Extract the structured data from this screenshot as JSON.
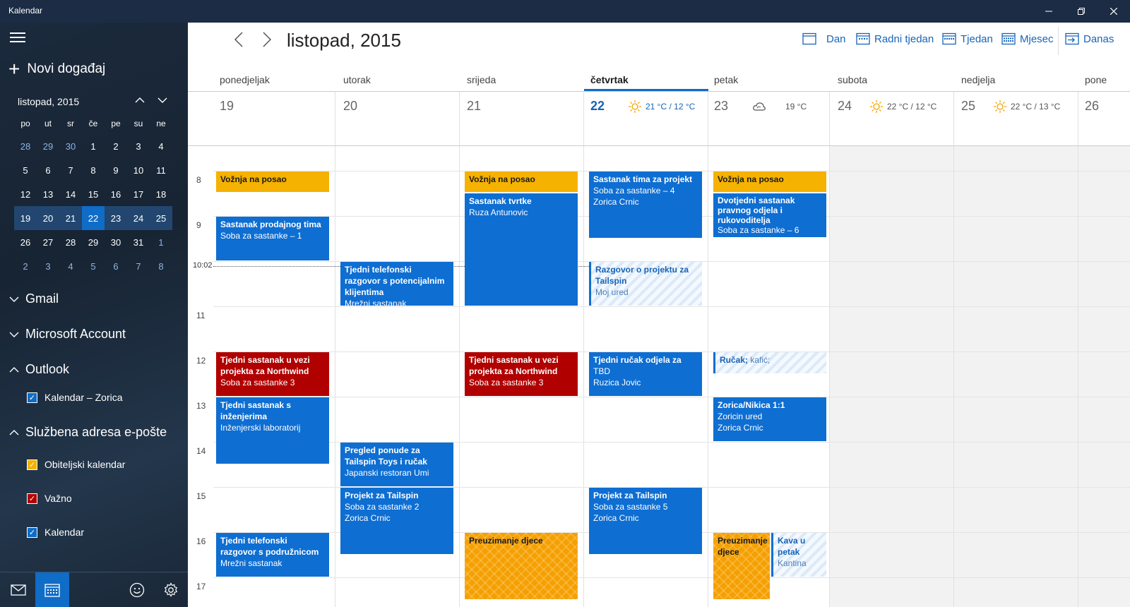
{
  "window": {
    "title": "Kalendar"
  },
  "sidebar": {
    "new_event": "Novi događaj",
    "mini_month": "listopad, 2015",
    "weekdays": [
      "po",
      "ut",
      "sr",
      "če",
      "pe",
      "su",
      "ne"
    ],
    "weeks": [
      [
        "28",
        "29",
        "30",
        "1",
        "2",
        "3",
        "4"
      ],
      [
        "5",
        "6",
        "7",
        "8",
        "9",
        "10",
        "11"
      ],
      [
        "12",
        "13",
        "14",
        "15",
        "16",
        "17",
        "18"
      ],
      [
        "19",
        "20",
        "21",
        "22",
        "23",
        "24",
        "25"
      ],
      [
        "26",
        "27",
        "28",
        "29",
        "30",
        "31",
        "1"
      ],
      [
        "2",
        "3",
        "4",
        "5",
        "6",
        "7",
        "8"
      ]
    ],
    "accounts": {
      "gmail": "Gmail",
      "microsoft": "Microsoft Account",
      "outlook": "Outlook",
      "work": "Službena adresa e-pošte"
    },
    "calendars": {
      "zorica": {
        "label": "Kalendar – Zorica",
        "color": "#0f6cc7"
      },
      "family": {
        "label": "Obiteljski kalendar",
        "color": "#f5b200"
      },
      "important": {
        "label": "Važno",
        "color": "#b10000"
      },
      "calendar": {
        "label": "Kalendar",
        "color": "#0f6cc7"
      }
    }
  },
  "header": {
    "title": "listopad, 2015",
    "views": {
      "day": "Dan",
      "work_week": "Radni tjedan",
      "week": "Tjedan",
      "month": "Mjesec",
      "today": "Danas"
    }
  },
  "days": [
    {
      "name": "ponedjeljak",
      "num": "19",
      "weather": ""
    },
    {
      "name": "utorak",
      "num": "20",
      "weather": ""
    },
    {
      "name": "srijeda",
      "num": "21",
      "weather": ""
    },
    {
      "name": "četvrtak",
      "num": "22",
      "weather": "21 °C / 12 °C"
    },
    {
      "name": "petak",
      "num": "23",
      "weather": "19 °C"
    },
    {
      "name": "subota",
      "num": "24",
      "weather": "22 °C / 12 °C"
    },
    {
      "name": "nedjelja",
      "num": "25",
      "weather": "22 °C / 13 °C"
    },
    {
      "name": "pone",
      "num": "26",
      "weather": ""
    }
  ],
  "hours": [
    "8",
    "9",
    "11",
    "12",
    "13",
    "14",
    "15",
    "16",
    "17"
  ],
  "now_time": "10:02",
  "events": {
    "mon_commute": {
      "title": "Vožnja na posao"
    },
    "mon_sales": {
      "title": "Sastanak prodajnog tima",
      "sub": "Soba za sastanke – 1"
    },
    "mon_northwind": {
      "title": "Tjedni sastanak u vezi projekta za Northwind",
      "sub": "Soba za sastanke 3"
    },
    "mon_eng": {
      "title": "Tjedni sastanak s inženjerima",
      "sub": "Inženjerski laboratorij"
    },
    "mon_phone": {
      "title": "Tjedni telefonski razgovor s podružnicom",
      "sub": "Mrežni sastanak"
    },
    "tue_phone": {
      "title": "Tjedni telefonski razgovor s potencijalnim klijentima",
      "sub": "Mrežni sastanak"
    },
    "tue_review": {
      "title": "Pregled ponude za Tailspin Toys i ručak",
      "sub": "Japanski restoran Umi"
    },
    "tue_tailspin": {
      "title": "Projekt za Tailspin",
      "sub": "Soba za sastanke 2",
      "sub2": "Zorica Crnic"
    },
    "wed_commute": {
      "title": "Vožnja na posao"
    },
    "wed_company": {
      "title": "Sastanak tvrtke",
      "sub": "Ruza Antunovic"
    },
    "wed_northwind": {
      "title": "Tjedni sastanak u vezi projekta za Northwind",
      "sub": "Soba za sastanke 3"
    },
    "wed_kids": {
      "title": "Preuzimanje djece"
    },
    "thu_team": {
      "title": "Sastanak tima za projekt",
      "sub": "Soba za sastanke – 4",
      "sub2": "Zorica Crnic"
    },
    "thu_call": {
      "title": "Razgovor o projektu za Tailspin",
      "sub": "Moj ured"
    },
    "thu_lunch": {
      "title": "Tjedni ručak odjela za",
      "sub": "TBD",
      "sub2": "Ruzica Jovic"
    },
    "thu_tailspin": {
      "title": "Projekt za Tailspin",
      "sub": "Soba za sastanke 5",
      "sub2": "Zorica Crnic"
    },
    "fri_commute": {
      "title": "Vožnja na posao"
    },
    "fri_legal": {
      "title": "Dvotjedni sastanak pravnog odjela i rukovoditelja",
      "sub": "Soba za sastanke – 6"
    },
    "fri_lunch": {
      "title": "Ručak;",
      "sub": "kafić;"
    },
    "fri_oneonone": {
      "title": "Zorica/Nikica 1:1",
      "sub": "Zoricin ured",
      "sub2": "Zorica Crnic"
    },
    "fri_kids": {
      "title": "Preuzimanje djece"
    },
    "fri_coffee": {
      "title": "Kava u petak",
      "sub": "Kantina"
    }
  },
  "colors": {
    "accent": "#0f6cc7",
    "titlebar": "#1b2c44",
    "event_blue": "#0e6ed2",
    "event_red": "#b10000",
    "event_yellow": "#f5b200"
  }
}
